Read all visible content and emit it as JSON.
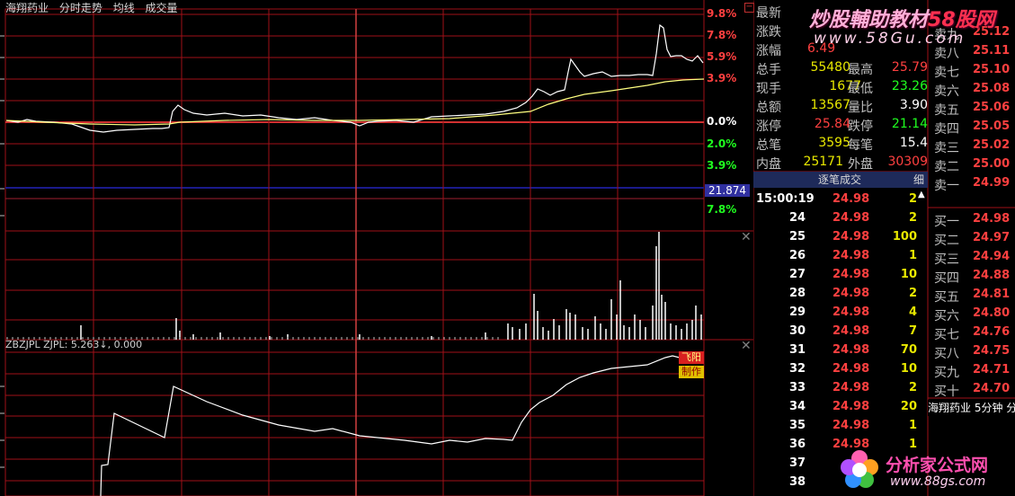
{
  "title_bar": {
    "stock": "海翔药业",
    "mode": "分时走势",
    "avg": "均线",
    "vol": "成交量"
  },
  "price_axis_up": [
    "9.8%",
    "7.8%",
    "5.9%",
    "3.9%"
  ],
  "price_axis_zero": "0.0%",
  "price_axis_down": [
    "2.0%",
    "3.9%"
  ],
  "vol_axis_top": "21.874",
  "vol_axis_pct": "7.8%",
  "indicator": {
    "name": "ZBZJPL",
    "line": "ZJPL:",
    "value": "5.263↓",
    "value2": "0.000"
  },
  "badges": {
    "b1": "飞阳",
    "b2": "制作"
  },
  "quote": {
    "labels": [
      "最新",
      "涨跌",
      "涨幅",
      "总手",
      "现手",
      "总额",
      "涨停",
      "总笔",
      "内盘"
    ],
    "rows": [
      {
        "l": "总手",
        "v": "55480",
        "l2": "最高",
        "v2": "25.79"
      },
      {
        "l": "现手",
        "v": "1677",
        "l2": "最低",
        "v2": "23.26"
      },
      {
        "l": "总额",
        "v": "13567",
        "l2": "量比",
        "v2": "3.90"
      },
      {
        "l": "涨停",
        "v": "25.84",
        "l2": "跌停",
        "v2": "21.14"
      },
      {
        "l": "总笔",
        "v": "3595",
        "l2": "每笔",
        "v2": "15.4"
      },
      {
        "l": "内盘",
        "v": "25171",
        "l2": "外盘",
        "v2": "30309"
      }
    ],
    "top": [
      {
        "l": "最新"
      },
      {
        "l": "涨跌"
      },
      {
        "l": "涨幅",
        "v": "6.49"
      }
    ]
  },
  "ticks_header": "逐笔成交",
  "ticks_header_right": "细",
  "ticks": [
    {
      "t": "15:00:19",
      "p": "24.98",
      "v": "2"
    },
    {
      "t": "24",
      "p": "24.98",
      "v": "2"
    },
    {
      "t": "25",
      "p": "24.98",
      "v": "100"
    },
    {
      "t": "26",
      "p": "24.98",
      "v": "1"
    },
    {
      "t": "27",
      "p": "24.98",
      "v": "10"
    },
    {
      "t": "28",
      "p": "24.98",
      "v": "2"
    },
    {
      "t": "29",
      "p": "24.98",
      "v": "4"
    },
    {
      "t": "30",
      "p": "24.98",
      "v": "7"
    },
    {
      "t": "31",
      "p": "24.98",
      "v": "70"
    },
    {
      "t": "32",
      "p": "24.98",
      "v": "10"
    },
    {
      "t": "33",
      "p": "24.98",
      "v": "2"
    },
    {
      "t": "34",
      "p": "24.98",
      "v": "20"
    },
    {
      "t": "35",
      "p": "24.98",
      "v": "1"
    },
    {
      "t": "36",
      "p": "24.98",
      "v": "1"
    },
    {
      "t": "37",
      "p": "",
      "v": ""
    },
    {
      "t": "38",
      "p": "",
      "v": ""
    }
  ],
  "asks": [
    {
      "l": "卖九",
      "p": "25.12"
    },
    {
      "l": "卖八",
      "p": "25.11"
    },
    {
      "l": "卖七",
      "p": "25.10"
    },
    {
      "l": "卖六",
      "p": "25.08"
    },
    {
      "l": "卖五",
      "p": "25.06"
    },
    {
      "l": "卖四",
      "p": "25.05"
    },
    {
      "l": "卖三",
      "p": "25.02"
    },
    {
      "l": "卖二",
      "p": "25.00"
    },
    {
      "l": "卖一",
      "p": "24.99"
    }
  ],
  "bids": [
    {
      "l": "买一",
      "p": "24.98"
    },
    {
      "l": "买二",
      "p": "24.97"
    },
    {
      "l": "买三",
      "p": "24.94"
    },
    {
      "l": "买四",
      "p": "24.88"
    },
    {
      "l": "买五",
      "p": "24.81"
    },
    {
      "l": "买六",
      "p": "24.80"
    },
    {
      "l": "买七",
      "p": "24.76"
    },
    {
      "l": "买八",
      "p": "24.75"
    },
    {
      "l": "买九",
      "p": "24.71"
    },
    {
      "l": "买十",
      "p": "24.70"
    }
  ],
  "bottom_tab": {
    "name": "海翔药业",
    "period": "5分钟",
    "more": "分"
  },
  "watermark": {
    "top": "炒股輔助教材",
    "top_mark": "58股网",
    "top_url": "www.58Gu.com",
    "bottom": "分析家公式网",
    "bottom_url": "www.88gs.com"
  },
  "colors": {
    "grid": "#a01018",
    "price": "#ffffff",
    "avg": "#ffff80",
    "up": "#ff4040",
    "down": "#20ff20"
  }
}
